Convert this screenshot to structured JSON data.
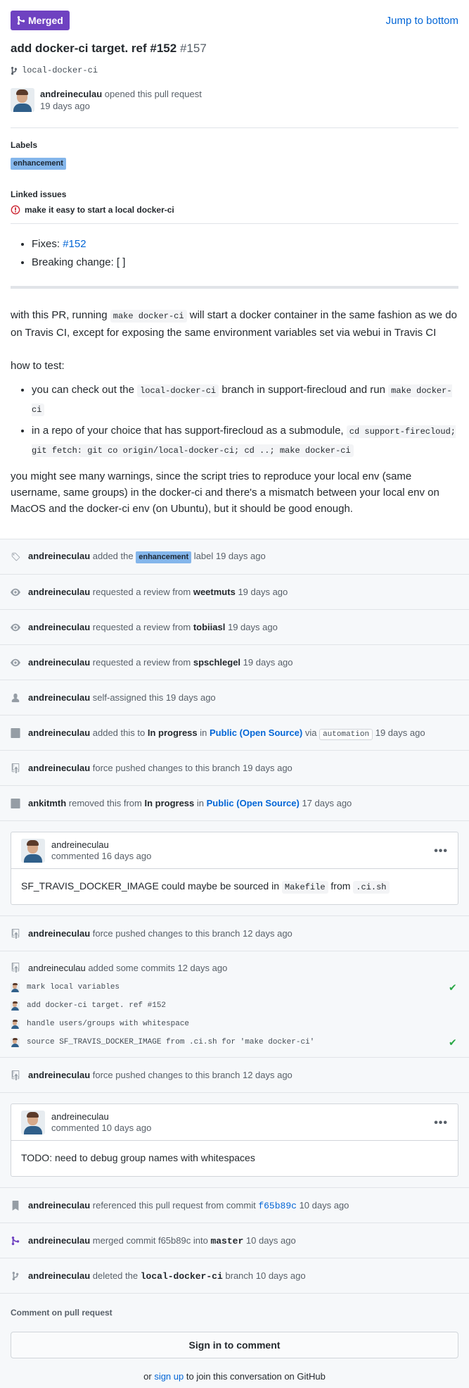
{
  "header": {
    "state_label": "Merged",
    "jump_label": "Jump to bottom",
    "title": "add docker-ci target. ref #152",
    "number": "#157",
    "branch": "local-docker-ci"
  },
  "opener": {
    "user": "andreineculau",
    "action": "opened this pull request",
    "time": "19 days ago"
  },
  "labels": {
    "heading": "Labels",
    "items": [
      "enhancement"
    ]
  },
  "linked_issues": {
    "heading": "Linked issues",
    "items": [
      "make it easy to start a local docker-ci"
    ]
  },
  "checklist": {
    "fixes_label": "Fixes:",
    "fixes_link": "#152",
    "breaking": "Breaking change: [ ]"
  },
  "body": {
    "p1_a": "with this PR, running",
    "p1_code": "make docker-ci",
    "p1_b": "will start a docker container in the same fashion as we do on Travis CI, except for exposing the same environment variables set via webui in Travis CI",
    "p2": "how to test:",
    "li1_a": "you can check out the",
    "li1_code1": "local-docker-ci",
    "li1_b": "branch in support-firecloud and run",
    "li1_code2": "make docker-ci",
    "li2_a": "in a repo of your choice that has support-firecloud as a submodule,",
    "li2_code": "cd support-firecloud; git fetch: git co origin/local-docker-ci; cd ..; make docker-ci",
    "p3": "you might see many warnings, since the script tries to reproduce your local env (same username, same groups) in the docker-ci and there's a mismatch between your local env on MacOS and the docker-ci env (on Ubuntu), but it should be good enough."
  },
  "events": {
    "e1": {
      "user": "andreineculau",
      "a": "added the",
      "label": "enhancement",
      "b": "label 19 days ago"
    },
    "e2": {
      "user": "andreineculau",
      "a": "requested a review from",
      "target": "weetmuts",
      "b": "19 days ago"
    },
    "e3": {
      "user": "andreineculau",
      "a": "requested a review from",
      "target": "tobiiasl",
      "b": "19 days ago"
    },
    "e4": {
      "user": "andreineculau",
      "a": "requested a review from",
      "target": "spschlegel",
      "b": "19 days ago"
    },
    "e5": {
      "user": "andreineculau",
      "a": "self-assigned this 19 days ago"
    },
    "e6": {
      "user": "andreineculau",
      "a": "added this to",
      "column": "In progress",
      "in": "in",
      "project": "Public (Open Source)",
      "via": "via",
      "tag": "automation",
      "b": "19 days ago"
    },
    "e7": {
      "user": "andreineculau",
      "a": "force pushed changes to this branch 19 days ago"
    },
    "e8": {
      "user": "ankitmth",
      "a": "removed this from",
      "column": "In progress",
      "in": "in",
      "project": "Public (Open Source)",
      "b": "17 days ago"
    },
    "c1": {
      "user": "andreineculau",
      "time": "commented 16 days ago",
      "text_a": "SF_TRAVIS_DOCKER_IMAGE could maybe be sourced in",
      "code1": "Makefile",
      "from": "from",
      "code2": ".ci.sh",
      "dots": "•••"
    },
    "e9": {
      "user": "andreineculau",
      "a": "force pushed changes to this branch 12 days ago"
    },
    "commits": {
      "user": "andreineculau",
      "a": "added some commits 12 days ago",
      "items": [
        {
          "msg": "mark local variables",
          "check": "✔"
        },
        {
          "msg": "add docker-ci target. ref #152",
          "check": ""
        },
        {
          "msg": "handle users/groups with whitespace",
          "check": ""
        },
        {
          "msg": "source SF_TRAVIS_DOCKER_IMAGE from .ci.sh for 'make docker-ci'",
          "check": "✔"
        }
      ]
    },
    "e10": {
      "user": "andreineculau",
      "a": "force pushed changes to this branch 12 days ago"
    },
    "c2": {
      "user": "andreineculau",
      "time": "commented 10 days ago",
      "text": "TODO: need to debug group names with whitespaces",
      "dots": "•••"
    },
    "e11": {
      "user": "andreineculau",
      "a": "referenced this pull request from commit",
      "sha": "f65b89c",
      "b": "10 days ago"
    },
    "e12": {
      "user": "andreineculau",
      "a": "merged commit",
      "sha": "f65b89c",
      "into": "into",
      "branch": "master",
      "b": "10 days ago"
    },
    "e13": {
      "user": "andreineculau",
      "a": "deleted the",
      "branch": "local-docker-ci",
      "b": "branch 10 days ago"
    }
  },
  "footer": {
    "heading": "Comment on pull request",
    "sign_in": "Sign in to comment",
    "or": "or",
    "sign_up": "sign up",
    "rest": "to join this conversation on GitHub"
  },
  "colors": {
    "merged": "#6f42c1",
    "link": "#0366d6",
    "label": "#84b6eb",
    "check": "#28a745"
  }
}
